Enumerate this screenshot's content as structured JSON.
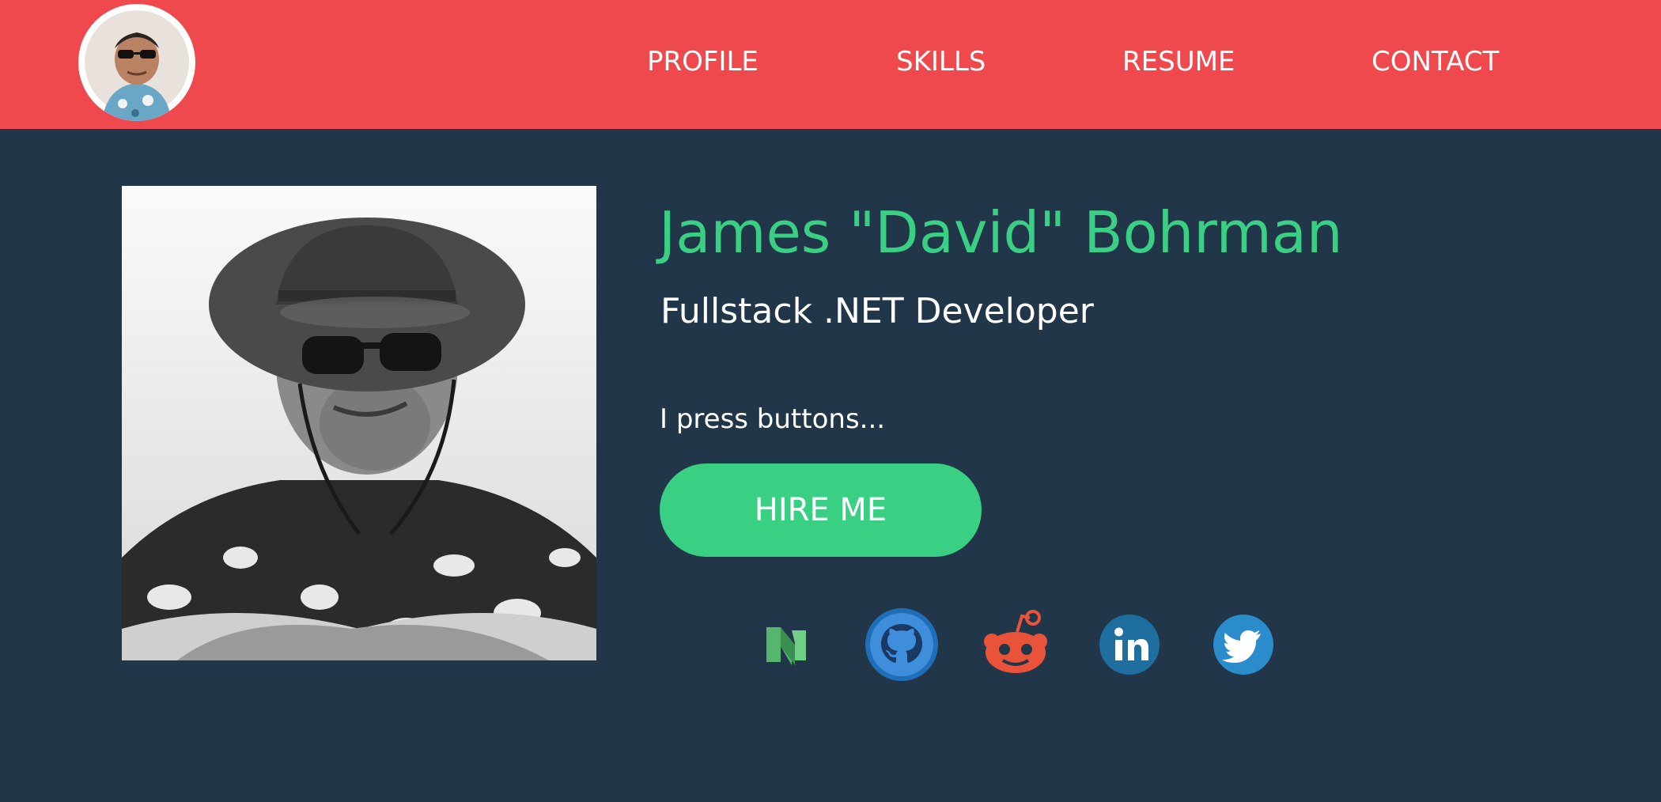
{
  "header": {
    "avatar_icon": "avatar-thumbnail",
    "nav": [
      {
        "label": "PROFILE"
      },
      {
        "label": "SKILLS"
      },
      {
        "label": "RESUME"
      },
      {
        "label": "CONTACT"
      }
    ]
  },
  "hero": {
    "name": "James \"David\" Bohrman",
    "role": "Fullstack .NET Developer",
    "tagline": "I press buttons...",
    "hire_label": "HIRE ME"
  },
  "social": [
    {
      "icon": "medium-icon"
    },
    {
      "icon": "github-icon"
    },
    {
      "icon": "reddit-icon"
    },
    {
      "icon": "linkedin-icon"
    },
    {
      "icon": "twitter-icon"
    }
  ],
  "colors": {
    "header_bg": "#F0494D",
    "page_bg": "#22364A",
    "accent": "#3AD083",
    "text": "#FFFFFF"
  }
}
